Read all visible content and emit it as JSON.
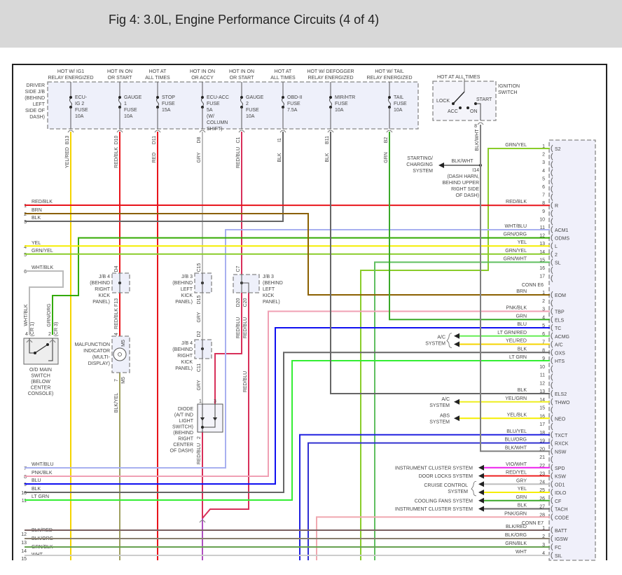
{
  "title": "Fig 4: 3.0L, Engine Performance Circuits (4 of 4)",
  "wire_colors": {
    "YEL/RED": "#f5d400",
    "RED/BLK": "#e8141b",
    "RED": "#e8141b",
    "GRY": "#bdbdbd",
    "RED/BLU": "#d8305a",
    "BLK": "#666666",
    "GRN": "#3aa829",
    "BLK/WHT": "#808080",
    "GRN/YEL": "#8acc2a",
    "WHT/BLU": "#a8b0f0",
    "GRN/ORG": "#33aa00",
    "YEL": "#f5ee00",
    "GRN/WHT": "#5fbf5f",
    "BRN": "#8b6000",
    "PNK/BLK": "#f0a0b4",
    "BLU": "#1010f0",
    "LT GRN/RED": "#66ee55",
    "LT GRN": "#33ee33",
    "YEL/GRN": "#eeee20",
    "YEL/BLK": "#f5ee00",
    "BLU/YEL": "#2020e0",
    "BLU/ORG": "#3030d0",
    "VIO/WHT": "#ee20ee",
    "RED/YEL": "#ee2020",
    "PNK/GRN": "#f0a8b0",
    "BLK/RED": "#7a6060",
    "BLK/ORG": "#8a8070",
    "GRN/BLK": "#66a050",
    "WHT": "#cccccc",
    "WHT/BLK": "#bbbbbb",
    "BLK/YEL": "#a0a060",
    "VIO": "#b050c0"
  },
  "fuse_box": {
    "label": [
      "DRIVER",
      "SIDE J/B",
      "(BEHIND",
      "LEFT",
      "SIDE OF",
      "DASH)"
    ]
  },
  "fuses": [
    {
      "supply": [
        "HOT W/ IG1",
        "RELAY ENERGIZED"
      ],
      "name": [
        "ECU-",
        "IG 2",
        "FUSE",
        "10A"
      ],
      "pin": "B13",
      "wire": "YEL/RED"
    },
    {
      "supply": [
        "HOT IN ON",
        "OR START"
      ],
      "name": [
        "GAUGE",
        "1",
        "FUSE",
        "10A"
      ],
      "pin": "D10",
      "wire": "RED/BLK"
    },
    {
      "supply": [
        "HOT AT",
        "ALL TIMES"
      ],
      "name": [
        "STOP",
        "FUSE",
        "15A"
      ],
      "pin": "D11",
      "wire": "RED"
    },
    {
      "supply": [
        "HOT IN ON",
        "OR ACCY"
      ],
      "name": [
        "ECU-ACC",
        "FUSE",
        "5A",
        "(W/",
        "COLUMN",
        "SHIFT)"
      ],
      "pin": "D8",
      "wire": "GRY"
    },
    {
      "supply": [
        "HOT IN ON",
        "OR START"
      ],
      "name": [
        "GAUGE",
        "2",
        "FUSE",
        "10A"
      ],
      "pin": "C1",
      "wire": "RED/BLU"
    },
    {
      "supply": [
        "HOT AT",
        "ALL TIMES"
      ],
      "name": [
        "OBD-II",
        "FUSE",
        "7.5A"
      ],
      "pin": "I1",
      "wire": "BLK"
    },
    {
      "supply": [
        "HOT W/ DEFOGGER",
        "RELAY ENERGIZED"
      ],
      "name": [
        "MIR/HTR",
        "FUSE",
        "10A"
      ],
      "pin": "B11",
      "wire": "BLK"
    },
    {
      "supply": [
        "HOT W/ TAIL",
        "RELAY ENERGIZED"
      ],
      "name": [
        "TAIL",
        "FUSE",
        "10A"
      ],
      "pin": "B2",
      "wire": "GRN"
    }
  ],
  "ignition": {
    "supply": "HOT AT ALL TIMES",
    "label": [
      "IGNITION",
      "SWITCH"
    ],
    "lock": "LOCK",
    "acc": "ACC",
    "on": "ON",
    "start": "START",
    "pin": "8",
    "wire": "BLK/WHT"
  },
  "splice": {
    "wire": "BLK/WHT",
    "id": "I14",
    "location": [
      "(DASH HARN,",
      "BEHIND UPPER",
      "RIGHT SIDE",
      "OF DASH)"
    ],
    "dest": [
      "STARTING/",
      "CHARGING",
      "SYSTEM"
    ]
  },
  "connector": {
    "top_pins": [
      {
        "num": "1",
        "wire": "GRN/YEL",
        "func": "S2"
      },
      {
        "num": "2",
        "wire": "",
        "func": ""
      },
      {
        "num": "3",
        "wire": "",
        "func": ""
      },
      {
        "num": "4",
        "wire": "",
        "func": ""
      },
      {
        "num": "5",
        "wire": "",
        "func": ""
      },
      {
        "num": "6",
        "wire": "",
        "func": ""
      },
      {
        "num": "7",
        "wire": "",
        "func": ""
      },
      {
        "num": "8",
        "wire": "RED/BLK",
        "func": "R"
      },
      {
        "num": "9",
        "wire": "",
        "func": ""
      },
      {
        "num": "10",
        "wire": "",
        "func": ""
      },
      {
        "num": "11",
        "wire": "WHT/BLU",
        "func": "ACM1"
      },
      {
        "num": "12",
        "wire": "GRN/ORG",
        "func": "ODMS"
      },
      {
        "num": "13",
        "wire": "YEL",
        "func": "L"
      },
      {
        "num": "14",
        "wire": "GRN/YEL",
        "func": "2"
      },
      {
        "num": "15",
        "wire": "GRN/WHT",
        "func": "SL"
      },
      {
        "num": "16",
        "wire": "",
        "func": ""
      },
      {
        "num": "17",
        "wire": "",
        "func": ""
      }
    ],
    "e6_label": "CONN E6",
    "e6_pins": [
      {
        "num": "1",
        "wire": "BRN",
        "func": "EOM"
      },
      {
        "num": "2",
        "wire": "",
        "func": ""
      },
      {
        "num": "3",
        "wire": "PNK/BLK",
        "func": "TBP"
      },
      {
        "num": "4",
        "wire": "GRN",
        "func": "ELS"
      },
      {
        "num": "5",
        "wire": "BLU",
        "func": "TC"
      },
      {
        "num": "6",
        "wire": "LT GRN/RED",
        "func": "ACMG"
      },
      {
        "num": "7",
        "wire": "YEL/RED",
        "func": "A/C"
      },
      {
        "num": "8",
        "wire": "BLK",
        "func": "OXS"
      },
      {
        "num": "9",
        "wire": "LT GRN",
        "func": "HTS"
      },
      {
        "num": "10",
        "wire": "",
        "func": ""
      },
      {
        "num": "11",
        "wire": "",
        "func": ""
      },
      {
        "num": "12",
        "wire": "",
        "func": ""
      },
      {
        "num": "13",
        "wire": "BLK",
        "func": "ELS2"
      },
      {
        "num": "14",
        "wire": "YEL/GRN",
        "func": "THWO"
      },
      {
        "num": "15",
        "wire": "",
        "func": ""
      },
      {
        "num": "16",
        "wire": "YEL/BLK",
        "func": "NEO"
      },
      {
        "num": "17",
        "wire": "",
        "func": ""
      },
      {
        "num": "18",
        "wire": "BLU/YEL",
        "func": "TXCT"
      },
      {
        "num": "19",
        "wire": "BLU/ORG",
        "func": "RXCK"
      },
      {
        "num": "20",
        "wire": "BLK/WHT",
        "func": "NSW"
      },
      {
        "num": "21",
        "wire": "",
        "func": ""
      },
      {
        "num": "22",
        "wire": "VIO/WHT",
        "func": "SPD"
      },
      {
        "num": "23",
        "wire": "RED/YEL",
        "func": "KSW"
      },
      {
        "num": "24",
        "wire": "GRY",
        "func": "OD1"
      },
      {
        "num": "25",
        "wire": "YEL",
        "func": "IDLO"
      },
      {
        "num": "26",
        "wire": "GRN",
        "func": "CF"
      },
      {
        "num": "27",
        "wire": "BLK",
        "func": "TACH"
      },
      {
        "num": "28",
        "wire": "PNK/GRN",
        "func": "CODE"
      }
    ],
    "e7_label": "CONN E7",
    "e7_pins": [
      {
        "num": "1",
        "wire": "BLK/RED",
        "func": "BATT"
      },
      {
        "num": "2",
        "wire": "BLK/ORG",
        "func": "IGSW"
      },
      {
        "num": "3",
        "wire": "GRN/BLK",
        "func": "FC"
      },
      {
        "num": "4",
        "wire": "WHT",
        "func": "SIL"
      }
    ]
  },
  "destinations": [
    {
      "label": [
        "A/C",
        "SYSTEM"
      ],
      "pins": [
        "6",
        "7"
      ]
    },
    {
      "label": [
        "A/C",
        "SYSTEM"
      ],
      "pins": [
        "14"
      ]
    },
    {
      "label": [
        "ABS",
        "SYSTEM"
      ],
      "pins": [
        "16"
      ]
    },
    {
      "label": [
        "INSTRUMENT CLUSTER SYSTEM"
      ],
      "pins": [
        "22"
      ]
    },
    {
      "label": [
        "DOOR LOCKS SYSTEM"
      ],
      "pins": [
        "23"
      ]
    },
    {
      "label": [
        "CRUISE CONTROL",
        "SYSTEM"
      ],
      "pins": [
        "24",
        "25"
      ]
    },
    {
      "label": [
        "COOLING FANS SYSTEM"
      ],
      "pins": [
        "26"
      ]
    },
    {
      "label": [
        "INSTRUMENT CLUSTER SYSTEM"
      ],
      "pins": [
        "27"
      ]
    }
  ],
  "left_pins": [
    {
      "num": "1",
      "wire": "RED/BLK"
    },
    {
      "num": "2",
      "wire": "BRN"
    },
    {
      "num": "3",
      "wire": "BLK"
    },
    {
      "num": "4",
      "wire": "YEL"
    },
    {
      "num": "5",
      "wire": "GRN/YEL"
    },
    {
      "num": "6",
      "wire": "WHT/BLK"
    },
    {
      "num": "7",
      "wire": "WHT/BLU"
    },
    {
      "num": "8",
      "wire": "PNK/BLK"
    },
    {
      "num": "9",
      "wire": "BLU"
    },
    {
      "num": "10",
      "wire": "BLK"
    },
    {
      "num": "11",
      "wire": "LT GRN"
    },
    {
      "num": "12",
      "wire": "BLK/RED"
    },
    {
      "num": "13",
      "wire": "BLK/ORG"
    },
    {
      "num": "14",
      "wire": "GRN/BLK"
    },
    {
      "num": "15",
      "wire": "WHT"
    }
  ],
  "components": [
    {
      "label": [
        "J/B 4",
        "(BEHIND",
        "RIGHT",
        "KICK",
        "PANEL)"
      ],
      "pins": [
        "D4",
        "F13"
      ]
    },
    {
      "label": [
        "MALFUNCTION",
        "INDICATOR",
        "(MULTI-",
        "DISPLAY)"
      ],
      "pins": [
        "4",
        "M5",
        "7",
        "M5"
      ]
    },
    {
      "label": [
        "J/B 3",
        "(BEHIND",
        "LEFT",
        "KICK",
        "PANEL)"
      ],
      "pins": [
        "C15",
        "D15"
      ]
    },
    {
      "label": [
        "J/B 4",
        "(BEHIND",
        "RIGHT",
        "KICK",
        "PANEL)"
      ],
      "pins": [
        "D2",
        "C11"
      ]
    },
    {
      "label": [
        "DIODE",
        "(A/T IND",
        "LIGHT",
        "SWITCH)",
        "(BEHIND",
        "RIGHT",
        "CENTER",
        "OF DASH)"
      ],
      "pins": [
        "1",
        "3",
        "2"
      ]
    },
    {
      "label": [
        "J/B 3",
        "(BEHIND",
        "LEFT",
        "KICK",
        "PANEL)"
      ],
      "pins": [
        "C7",
        "D20",
        "C20"
      ]
    },
    {
      "label": [
        "O/D MAIN",
        "SWITCH",
        "(BELOW",
        "CENTER",
        "CONSOLE)"
      ],
      "pins": [
        "4",
        "(CR 1)",
        "2",
        "(CR 3)"
      ]
    }
  ],
  "wire_labels": {
    "mil_in": "RED/BLK",
    "mil_out": "BLK/YEL",
    "gry_1": "GRY",
    "gry_2": "GRY",
    "diode_out": "RED/BLU",
    "diode_in": "RED/BLU",
    "jb3_d20": "RED/BLU",
    "jb3_c20": "RED/BLU",
    "od_left": "WHT/BLK",
    "od_right": "GRN/ORG"
  }
}
